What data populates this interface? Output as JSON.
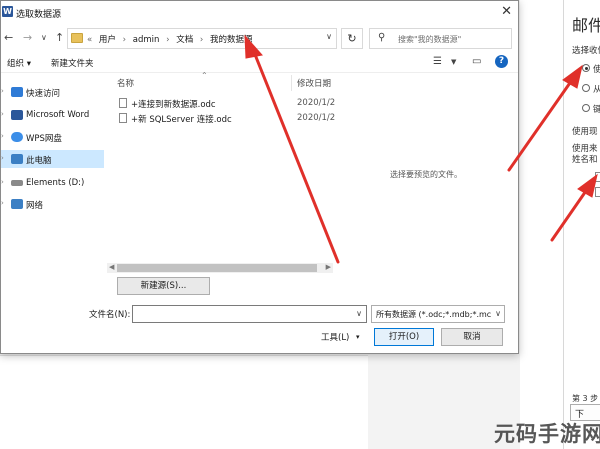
{
  "dialog": {
    "title": "选取数据源",
    "breadcrumb": [
      "用户",
      "admin",
      "文档",
      "我的数据源"
    ],
    "search_placeholder": "搜索\"我的数据源\"",
    "toolbar": {
      "organize": "组织 ▾",
      "new_folder": "新建文件夹"
    },
    "nav_items": [
      {
        "label": "快速访问",
        "icon": "star-icon",
        "color": "#2f7bd6"
      },
      {
        "label": "Microsoft Word",
        "icon": "word-icon",
        "color": "#2b579a"
      },
      {
        "label": "WPS网盘",
        "icon": "cloud-icon",
        "color": "#3c8ee8"
      },
      {
        "label": "此电脑",
        "icon": "computer-icon",
        "color": "#3b7fc4",
        "selected": true
      },
      {
        "label": "Elements (D:)",
        "icon": "drive-icon",
        "color": "#8a8a8a"
      },
      {
        "label": "网络",
        "icon": "network-icon",
        "color": "#3b7fc4"
      }
    ],
    "columns": {
      "name": "名称",
      "date": "修改日期"
    },
    "files": [
      {
        "name": "+连接到新数据源.odc",
        "date": "2020/1/2"
      },
      {
        "name": "+新 SQLServer 连接.odc",
        "date": "2020/1/2"
      }
    ],
    "preview_text": "选择要预览的文件。",
    "new_source_button": "新建源(S)...",
    "filename_label": "文件名(N):",
    "filename_value": "",
    "filetype_value": "所有数据源 (*.odc;*.mdb;*.mc",
    "tools_label": "工具(L)",
    "open_button": "打开(O)",
    "cancel_button": "取消"
  },
  "pane": {
    "title": "邮件",
    "section1": "选择收件",
    "options": [
      "使",
      "从",
      "键"
    ],
    "section2": "使用现",
    "desc": [
      "使用来",
      "姓名和"
    ],
    "footer": "第 3 步",
    "next_button": "下"
  },
  "watermark": "元码手游网",
  "colors": {
    "annotation_red": "#e0302a",
    "selection": "#cce8ff",
    "accent": "#0078d7"
  }
}
